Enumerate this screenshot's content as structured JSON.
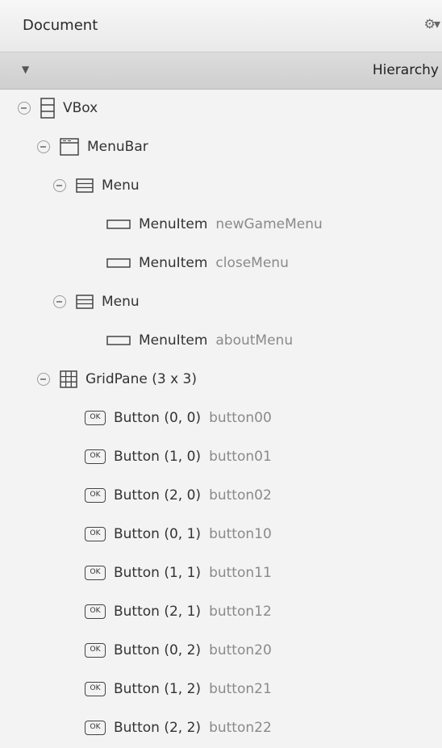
{
  "panel": {
    "title": "Document",
    "gear_icon": "gear-icon",
    "section_label": "Hierarchy"
  },
  "tree": {
    "vbox": "VBox",
    "menubar": "MenuBar",
    "menu1": "Menu",
    "menu1_items": [
      {
        "type": "MenuItem",
        "id": "newGameMenu"
      },
      {
        "type": "MenuItem",
        "id": "closeMenu"
      }
    ],
    "menu2": "Menu",
    "menu2_items": [
      {
        "type": "MenuItem",
        "id": "aboutMenu"
      }
    ],
    "gridpane": "GridPane (3 x 3)",
    "ok_label": "OK",
    "buttons": [
      {
        "type": "Button (0, 0)",
        "id": "button00"
      },
      {
        "type": "Button (1, 0)",
        "id": "button01"
      },
      {
        "type": "Button (2, 0)",
        "id": "button02"
      },
      {
        "type": "Button (0, 1)",
        "id": "button10"
      },
      {
        "type": "Button (1, 1)",
        "id": "button11"
      },
      {
        "type": "Button (2, 1)",
        "id": "button12"
      },
      {
        "type": "Button (0, 2)",
        "id": "button20"
      },
      {
        "type": "Button (1, 2)",
        "id": "button21"
      },
      {
        "type": "Button (2, 2)",
        "id": "button22"
      }
    ]
  }
}
